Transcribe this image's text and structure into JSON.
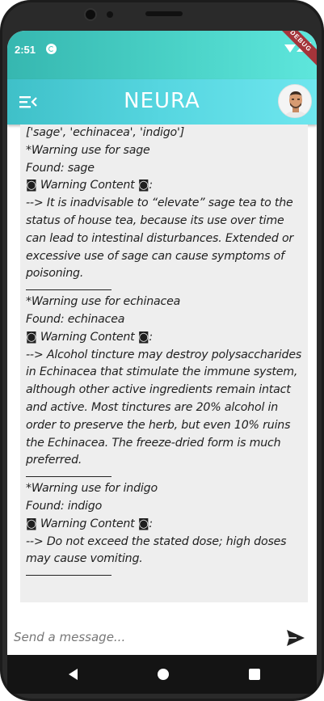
{
  "status_bar": {
    "time": "2:51",
    "sync_icon": "sync-icon",
    "wifi_icon": "wifi-icon",
    "signal_icon": "signal-icon",
    "battery_icon": "battery-icon",
    "debug_banner": "DEBUG"
  },
  "app_bar": {
    "menu_icon": "menu-collapse-icon",
    "title": "NEURA",
    "avatar": "user-avatar"
  },
  "chat": {
    "lines": [
      "['sage', 'echinacea', 'indigo']",
      "*Warning use for sage",
      "Found: sage",
      "◙ Warning Content ◙:",
      "--> It is inadvisable to “elevate” sage tea to the",
      "status of house tea, because its use over time",
      "can lead to intestinal disturbances.  Extended or",
      "excessive use of sage can cause symptoms of",
      "poisoning.",
      "*Warning use for echinacea",
      "Found: echinacea",
      "◙ Warning Content ◙:",
      "--> Alcohol tincture may destroy polysaccharides",
      "in Echinacea that stimulate the immune system,",
      "although other active ingredients remain intact",
      "and active. Most tinctures are 20% alcohol in",
      "order to preserve the herb, but even 10% ruins",
      "the Echinacea. The freeze-dried form is much",
      "preferred.",
      "*Warning use for indigo",
      "Found: indigo",
      "◙ Warning Content ◙:",
      "--> Do not exceed the stated dose; high doses",
      "may cause vomiting."
    ]
  },
  "input": {
    "placeholder": "Send a message...",
    "value": "",
    "send_icon": "send-icon"
  },
  "nav_bar": {
    "back_icon": "back-icon",
    "home_icon": "home-icon",
    "recents_icon": "recents-icon"
  },
  "colors": {
    "accent_start": "#36b7b0",
    "accent_end": "#6ee6ee",
    "chat_background": "#eeeeee",
    "debug_ribbon": "#a4343a"
  }
}
